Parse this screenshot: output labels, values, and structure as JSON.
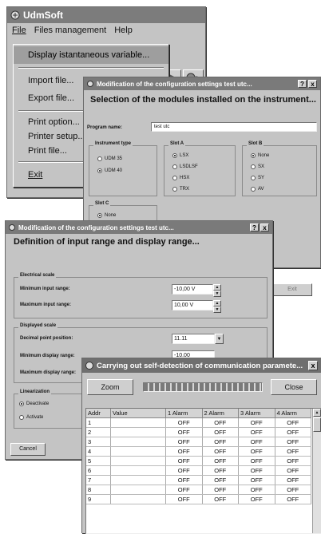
{
  "app": {
    "title": "UdmSoft",
    "menu": [
      "File",
      "Files management",
      "Help"
    ],
    "file_menu": {
      "items_group1": [
        "Display istantaneous variable..."
      ],
      "items_group2": [
        "Import file...",
        "Export file..."
      ],
      "items_group3": [
        "Print option...",
        "Printer setup...",
        "Print file..."
      ],
      "items_group4": [
        "Exit"
      ]
    }
  },
  "config_dialog": {
    "title": "Modification of the configuration settings test utc...",
    "help_btn": "?",
    "close_btn": "x",
    "heading": "Selection of the modules installed on the instrument...",
    "program_name_label": "Program name:",
    "program_name_value": "test utc",
    "instrument_type": {
      "label": "Instrument type",
      "options": [
        "UDM 35",
        "UDM 40"
      ],
      "selected": 1
    },
    "slot_a": {
      "label": "Slot A",
      "options": [
        "LSX",
        "LSDLSF",
        "HSX",
        "TRX"
      ],
      "selected": 0
    },
    "slot_b": {
      "label": "Slot B",
      "options": [
        "None",
        "SX",
        "SY",
        "AV"
      ],
      "selected": 0
    },
    "slot_c": {
      "label": "Slot C",
      "options": [
        "None"
      ],
      "selected": 0
    },
    "exit_btn": "Exit"
  },
  "range_dialog": {
    "title": "Modification of the configuration settings test utc...",
    "help_btn": "?",
    "close_btn": "x",
    "heading": "Definition of input range and display range...",
    "electrical_scale": {
      "label": "Electrical scale",
      "min_label": "Minimum input range:",
      "min_value": "-10,00 V",
      "max_label": "Maximum input range:",
      "max_value": "10,00 V"
    },
    "displayed_scale": {
      "label": "Displayed scale",
      "decimal_label": "Decimal point position:",
      "decimal_value": "11.11",
      "min_label": "Minimum display range:",
      "min_value": "-10.00",
      "max_label": "Maximum display range:"
    },
    "linearization": {
      "label": "Linearization",
      "options": [
        "Deactivate",
        "Activate"
      ],
      "selected": 0
    },
    "cancel_btn": "Cancel"
  },
  "detect_dialog": {
    "title": "Carrying out self-detection of communication paramete...",
    "close_x": "x",
    "zoom_btn": "Zoom",
    "close_btn": "Close",
    "columns": [
      "Addr",
      "Value",
      "1 Alarm",
      "2 Alarm",
      "3 Alarm",
      "4 Alarm"
    ],
    "rows": [
      [
        "1",
        "",
        "OFF",
        "OFF",
        "OFF",
        "OFF"
      ],
      [
        "2",
        "",
        "OFF",
        "OFF",
        "OFF",
        "OFF"
      ],
      [
        "3",
        "",
        "OFF",
        "OFF",
        "OFF",
        "OFF"
      ],
      [
        "4",
        "",
        "OFF",
        "OFF",
        "OFF",
        "OFF"
      ],
      [
        "5",
        "",
        "OFF",
        "OFF",
        "OFF",
        "OFF"
      ],
      [
        "6",
        "",
        "OFF",
        "OFF",
        "OFF",
        "OFF"
      ],
      [
        "7",
        "",
        "OFF",
        "OFF",
        "OFF",
        "OFF"
      ],
      [
        "8",
        "",
        "OFF",
        "OFF",
        "OFF",
        "OFF"
      ],
      [
        "9",
        "",
        "OFF",
        "OFF",
        "OFF",
        "OFF"
      ]
    ]
  }
}
